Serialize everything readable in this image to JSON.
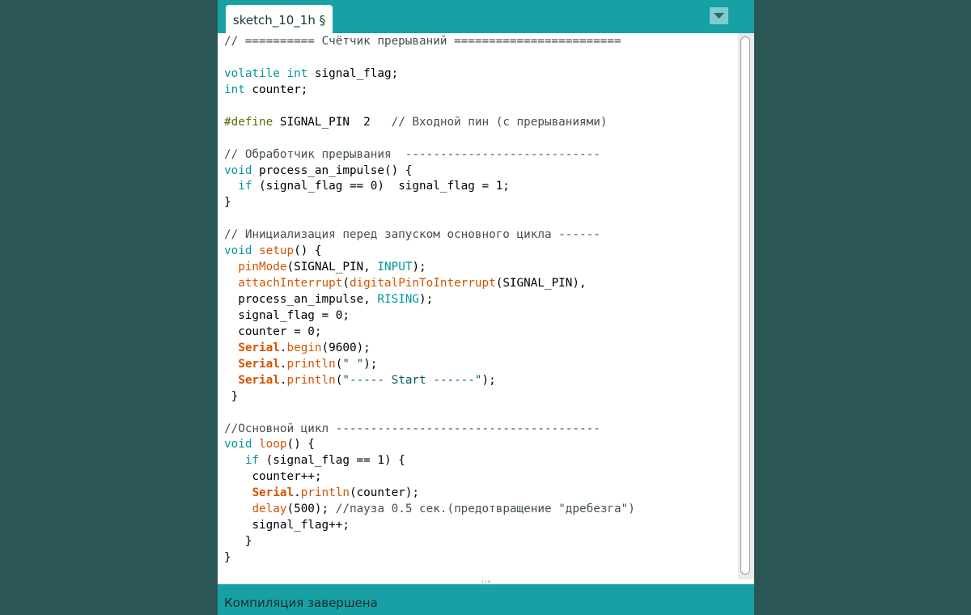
{
  "tab": {
    "label": "sketch_10_1h §"
  },
  "tab_menu": {
    "icon": "triangle-down-icon"
  },
  "colors": {
    "frame": "#17a1a5",
    "background": "#2a5653",
    "keyword": "#00979c",
    "function": "#d35400",
    "preprocessor": "#5e6d03",
    "comment": "#434f54",
    "string": "#005c5f"
  },
  "code": {
    "l01": "// ========== Счётчик прерываний ========================",
    "l03_kw1": "volatile",
    "l03_kw2": "int",
    "l03_rest": " signal_flag;",
    "l04_kw": "int",
    "l04_rest": " counter;",
    "l06_pre": "#define",
    "l06_rest": " SIGNAL_PIN  2   ",
    "l06_com": "// Входной пин (с прерываниями)",
    "l08_com": "// Обработчик прерывания  ----------------------------",
    "l09_kw": "void",
    "l09_rest": " process_an_impulse() {",
    "l10_kw": "if",
    "l10_rest": " (signal_flag == 0)  signal_flag = 1;",
    "l11": "}",
    "l13_com": "// Инициализация перед запуском основного цикла ------",
    "l14_kw": "void",
    "l14_fn": "setup",
    "l14_rest": "() {",
    "l15_fn": "pinMode",
    "l15_mid": "(SIGNAL_PIN, ",
    "l15_lit": "INPUT",
    "l15_end": ");",
    "l16_fn1": "attachInterrupt",
    "l16_p": "(",
    "l16_fn2": "digitalPinToInterrupt",
    "l16_rest": "(SIGNAL_PIN),",
    "l17_rest": "process_an_impulse, ",
    "l17_lit": "RISING",
    "l17_end": ");",
    "l18": "signal_flag = 0;",
    "l19": "counter = 0;",
    "l20_obj": "Serial",
    "l20_fn": "begin",
    "l20_rest": "(9600);",
    "l21_obj": "Serial",
    "l21_fn": "println",
    "l21_p": "(",
    "l21_str": "\" \"",
    "l21_end": ");",
    "l22_obj": "Serial",
    "l22_fn": "println",
    "l22_p": "(",
    "l22_str": "\"----- Start ------\"",
    "l22_end": ");",
    "l23": " }",
    "l25_com": "//Основной цикл --------------------------------------",
    "l26_kw": "void",
    "l26_fn": "loop",
    "l26_rest": "() {",
    "l27_kw": "if",
    "l27_rest": " (signal_flag == 1) {",
    "l28": "counter++;",
    "l29_obj": "Serial",
    "l29_fn": "println",
    "l29_rest": "(counter);",
    "l30_fn": "delay",
    "l30_rest": "(500); ",
    "l30_com": "//пауза 0.5 сек.(предотвращение \"дребезга\")",
    "l31": "signal_flag++;",
    "l32": "}",
    "l33": "}"
  },
  "status": {
    "message": "Компиляция завершена"
  }
}
